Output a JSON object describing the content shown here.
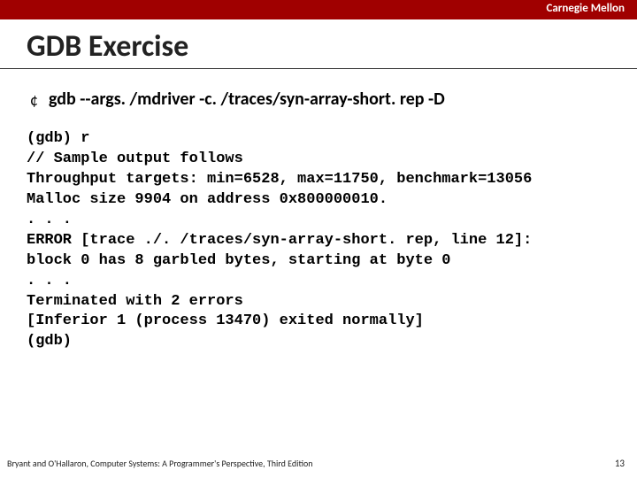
{
  "header": {
    "brand": "Carnegie Mellon"
  },
  "title": "GDB Exercise",
  "bullet": {
    "symbol": "¢",
    "text": "gdb --args. /mdriver -c. /traces/syn-array-short. rep -D"
  },
  "code": "(gdb) r\n// Sample output follows\nThroughput targets: min=6528, max=11750, benchmark=13056\nMalloc size 9904 on address 0x800000010.\n. . .\nERROR [trace ./. /traces/syn-array-short. rep, line 12]:\nblock 0 has 8 garbled bytes, starting at byte 0\n. . .\nTerminated with 2 errors\n[Inferior 1 (process 13470) exited normally]\n(gdb)",
  "footer": {
    "citation": "Bryant and O'Hallaron, Computer Systems: A Programmer's Perspective, Third Edition",
    "page": "13"
  }
}
